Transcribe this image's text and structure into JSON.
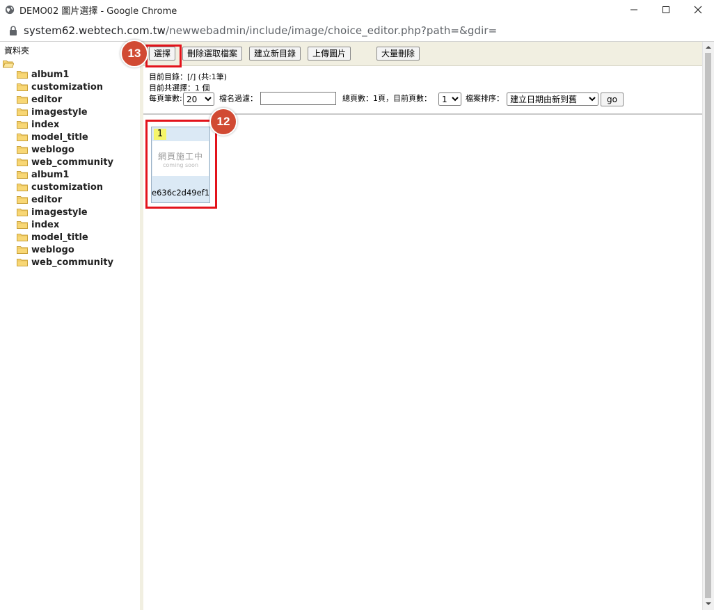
{
  "window": {
    "title": "DEMO02 圖片選擇 - Google Chrome",
    "url_host": "system62.webtech.com.tw",
    "url_path": "/newwebadmin/include/image/choice_editor.php?path=&gdir="
  },
  "sidebar": {
    "heading": "資料夾",
    "folders": [
      {
        "label": "album1"
      },
      {
        "label": "customization"
      },
      {
        "label": "editor"
      },
      {
        "label": "imagestyle"
      },
      {
        "label": "index"
      },
      {
        "label": "model_title"
      },
      {
        "label": "weblogo"
      },
      {
        "label": "web_community"
      },
      {
        "label": "album1"
      },
      {
        "label": "customization"
      },
      {
        "label": "editor"
      },
      {
        "label": "imagestyle"
      },
      {
        "label": "index"
      },
      {
        "label": "model_title"
      },
      {
        "label": "weblogo"
      },
      {
        "label": "web_community"
      }
    ]
  },
  "toolbar": {
    "select_label": "選擇",
    "delete_selected_label": "刪除選取檔案",
    "new_folder_label": "建立新目錄",
    "upload_label": "上傳圖片",
    "bulk_delete_label": "大量刪除"
  },
  "info": {
    "current_dir": "目前目錄：[/] (共:1筆)",
    "selected_count": "目前共選擇：1 個"
  },
  "controls": {
    "per_page_label": "每頁筆數:",
    "per_page_value": "20",
    "filter_label": "檔名過濾：",
    "filter_value": "",
    "total_pages_label": "總頁數：1頁，目前頁數：",
    "current_page_value": "1",
    "sort_label": "檔案排序：",
    "sort_value": "建立日期由新到舊",
    "go_label": "go"
  },
  "thumbnails": [
    {
      "number": "1",
      "image_text_zh": "網頁施工中",
      "image_text_en": "coming soon",
      "filename": "e636c2d49ef1"
    }
  ],
  "annotations": {
    "badge_select": "13",
    "badge_thumb": "12"
  }
}
